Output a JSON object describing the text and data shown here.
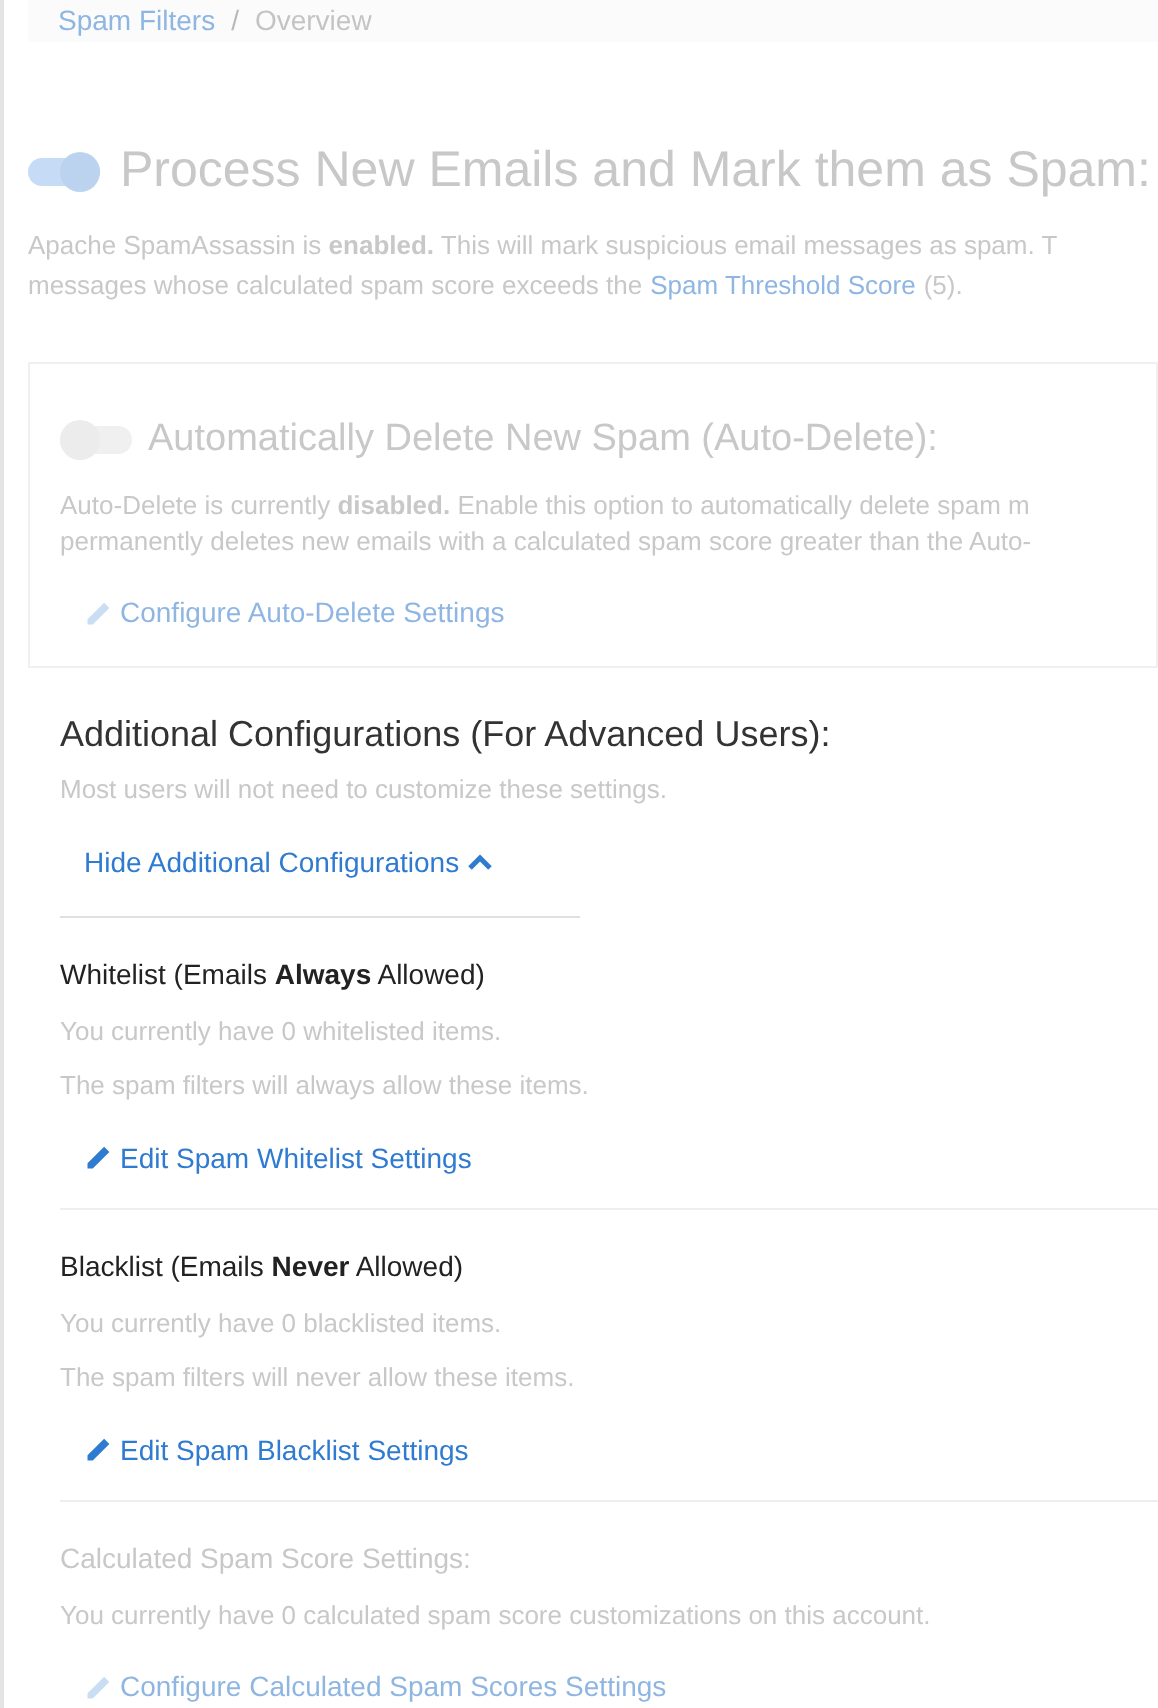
{
  "breadcrumb": [
    {
      "label": "Spam Filters",
      "kind": "link"
    },
    {
      "label": "/",
      "kind": "separator"
    },
    {
      "label": "Overview",
      "kind": "current"
    }
  ],
  "process_spam": {
    "dimmed": true,
    "on": true,
    "title": "Process New Emails and Mark them as Spam:",
    "lines": [
      {
        "text": "Apache SpamAssassin is **enabled.** This will mark suspicious email messages as spam. T"
      },
      {
        "text": "messages whose calculated spam score exceeds the",
        "link": "Spam Threshold Score",
        "after": "(5)."
      }
    ]
  },
  "auto_delete": {
    "dimmed": true,
    "on": false,
    "title": "Automatically Delete New Spam (Auto-Delete):",
    "lines": [
      {
        "text": "Auto-Delete is currently **disabled.** Enable this option to automatically delete spam m"
      },
      {
        "text": "permanently deletes new emails with a calculated spam score greater than the Auto-"
      }
    ],
    "action": "Configure Auto-Delete Settings"
  },
  "additional": {
    "dimmed": false,
    "title": "Additional Configurations (For Advanced Users):",
    "subtitle": "Most users will not need to customize these settings.",
    "toggle_link": "Hide Additional Configurations",
    "expanded": true
  },
  "sections": [
    {
      "dimmed": false,
      "title": "Whitelist (Emails **Always** Allowed)",
      "lines": [
        "You currently have 0 whitelisted items.",
        "The spam filters will always allow these items."
      ],
      "action": "Edit Spam Whitelist Settings"
    },
    {
      "dimmed": false,
      "title": "Blacklist (Emails **Never** Allowed)",
      "lines": [
        "You currently have 0 blacklisted items.",
        "The spam filters will never allow these items."
      ],
      "action": "Edit Spam Blacklist Settings"
    },
    {
      "dimmed": true,
      "title": "Calculated Spam Score Settings:",
      "lines": [
        "You currently have 0 calculated spam score customizations on this account."
      ],
      "action": "Configure Calculated Spam Scores Settings"
    }
  ]
}
